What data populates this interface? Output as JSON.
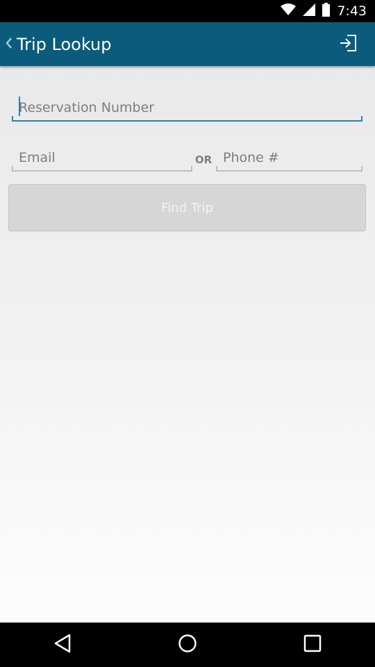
{
  "status_bar": {
    "time": "7:43"
  },
  "app_bar": {
    "title": "Trip Lookup"
  },
  "form": {
    "reservation": {
      "placeholder": "Reservation Number",
      "value": ""
    },
    "email": {
      "placeholder": "Email",
      "value": ""
    },
    "or_label": "OR",
    "phone": {
      "placeholder": "Phone #",
      "value": ""
    },
    "find_button": "Find Trip"
  },
  "colors": {
    "app_bar": "#0b5c7c",
    "accent": "#2b7fb0",
    "button_disabled": "#d6d6d6"
  }
}
